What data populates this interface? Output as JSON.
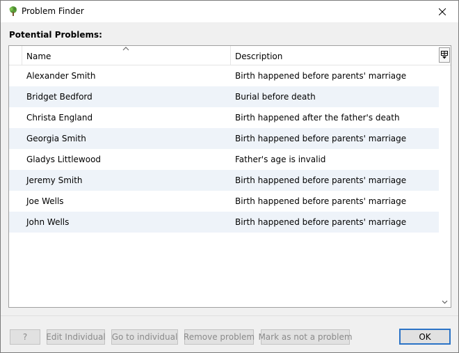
{
  "window": {
    "title": "Problem Finder",
    "icon": "tree-icon"
  },
  "section_label": "Potential Problems:",
  "table": {
    "columns": [
      "Name",
      "Description"
    ],
    "sort_column": "Name",
    "sort_direction": "ascending",
    "rows": [
      {
        "name": "Alexander Smith",
        "description": "Birth happened before parents' marriage"
      },
      {
        "name": "Bridget Bedford",
        "description": "Burial before death"
      },
      {
        "name": "Christa England",
        "description": "Birth happened after the father's death"
      },
      {
        "name": "Georgia Smith",
        "description": "Birth happened before parents' marriage"
      },
      {
        "name": "Gladys Littlewood",
        "description": "Father's age is invalid"
      },
      {
        "name": "Jeremy Smith",
        "description": "Birth happened before parents' marriage"
      },
      {
        "name": "Joe Wells",
        "description": "Birth happened before parents' marriage"
      },
      {
        "name": "John Wells",
        "description": "Birth happened before parents' marriage"
      }
    ]
  },
  "buttons": {
    "help": "?",
    "edit": "Edit Individual",
    "goto": "Go to individual",
    "remove": "Remove problem",
    "mark": "Mark as not a problem",
    "ok": "OK"
  },
  "colors": {
    "alt_row": "#eef3f9",
    "ok_border": "#2b73c6",
    "disabled_text": "#8a8a8a"
  }
}
